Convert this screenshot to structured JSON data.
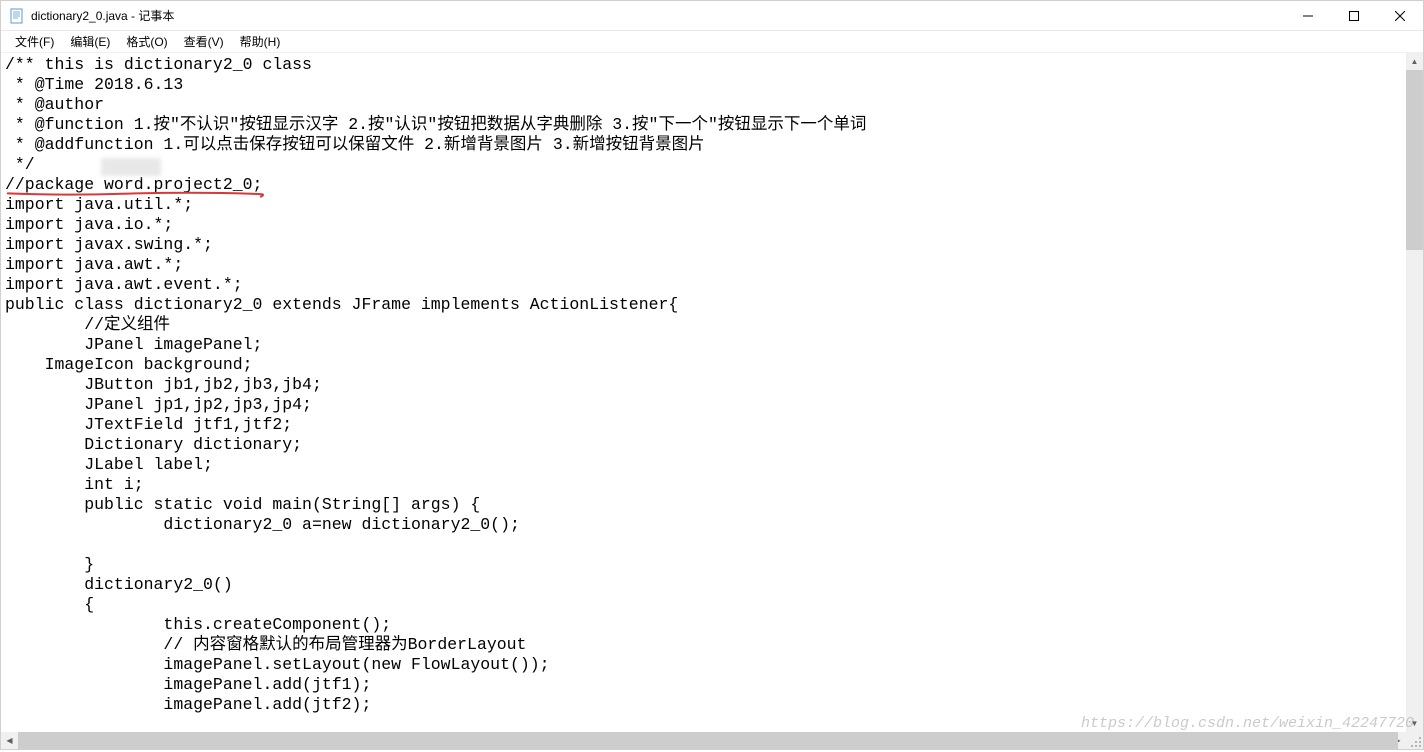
{
  "window": {
    "title": "dictionary2_0.java - 记事本"
  },
  "menubar": {
    "file": "文件(F)",
    "edit": "编辑(E)",
    "format": "格式(O)",
    "view": "查看(V)",
    "help": "帮助(H)"
  },
  "code": "/** this is dictionary2_0 class\n * @Time 2018.6.13\n * @author\n * @function 1.按\"不认识\"按钮显示汉字 2.按\"认识\"按钮把数据从字典删除 3.按\"下一个\"按钮显示下一个单词\n * @addfunction 1.可以点击保存按钮可以保留文件 2.新增背景图片 3.新增按钮背景图片\n */\n//package word.project2_0;\nimport java.util.*;\nimport java.io.*;\nimport javax.swing.*;\nimport java.awt.*;\nimport java.awt.event.*;\npublic class dictionary2_0 extends JFrame implements ActionListener{\n        //定义组件\n        JPanel imagePanel;\n    ImageIcon background;\n        JButton jb1,jb2,jb3,jb4;\n        JPanel jp1,jp2,jp3,jp4;\n        JTextField jtf1,jtf2;\n        Dictionary dictionary;\n        JLabel label;\n        int i;\n        public static void main(String[] args) {\n                dictionary2_0 a=new dictionary2_0();\n\n        }\n        dictionary2_0()\n        {\n                this.createComponent();\n                // 内容窗格默认的布局管理器为BorderLayout\n                imagePanel.setLayout(new FlowLayout());\n                imagePanel.add(jtf1);\n                imagePanel.add(jtf2);",
  "watermark": "https://blog.csdn.net/weixin_42247720"
}
